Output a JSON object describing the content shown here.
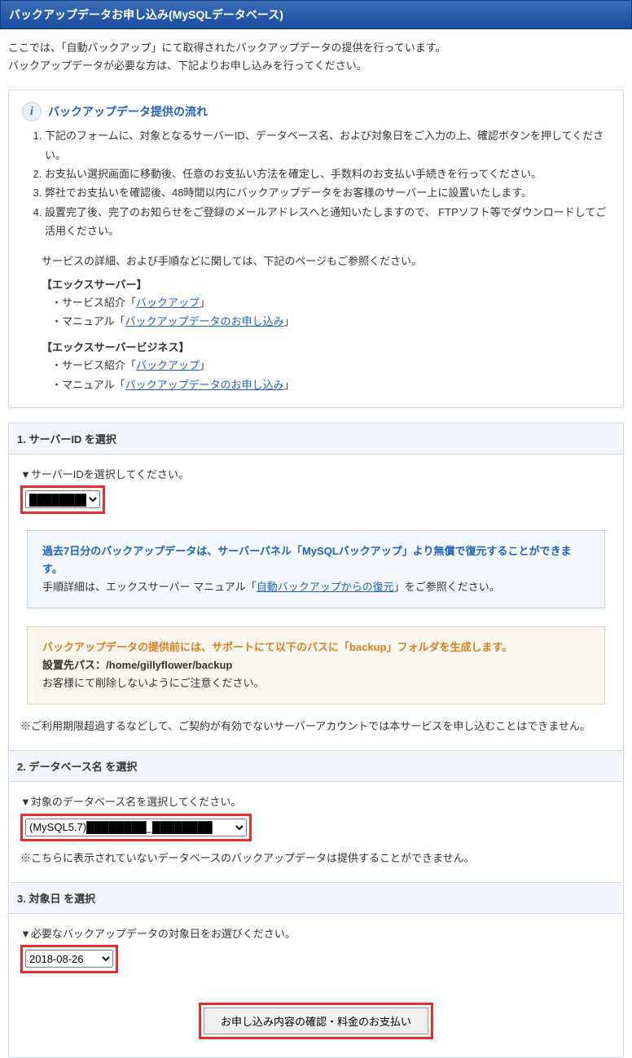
{
  "title": "バックアップデータお申し込み(MySQLデータベース)",
  "intro": {
    "line1": "ここでは、「自動バックアップ」にて取得されたバックアップデータの提供を行っています。",
    "line2": "バックアップデータが必要な方は、下記よりお申し込みを行ってください。"
  },
  "info": {
    "heading": "バックアップデータ提供の流れ",
    "steps": [
      "下記のフォームに、対象となるサーバーID、データベース名、および対象日をご入力の上、確認ボタンを押してください。",
      "お支払い選択画面に移動後、任意のお支払い方法を確定し、手数料のお支払い手続きを行ってください。",
      "弊社でお支払いを確認後、48時間以内にバックアップデータをお客様のサーバー上に設置いたします。",
      "設置完了後、完了のお知らせをご登録のメールアドレスへと通知いたしますので、 FTPソフト等でダウンロードしてご活用ください。"
    ],
    "detail_line": "サービスの詳細、および手順などに関しては、下記のページもご参照ください。",
    "groups": [
      {
        "head": "【エックスサーバー】",
        "lines": [
          {
            "prefix": "・サービス紹介「",
            "link": "バックアップ",
            "suffix": "」"
          },
          {
            "prefix": "・マニュアル「",
            "link": "バックアップデータのお申し込み",
            "suffix": "」"
          }
        ]
      },
      {
        "head": "【エックスサーバービジネス】",
        "lines": [
          {
            "prefix": "・サービス紹介「",
            "link": "バックアップ",
            "suffix": "」"
          },
          {
            "prefix": "・マニュアル「",
            "link": "バックアップデータのお申し込み",
            "suffix": "」"
          }
        ]
      }
    ]
  },
  "sec1": {
    "title": "1. サーバーID を選択",
    "label": "▼サーバーIDを選択してください。",
    "select_value": "████████",
    "bluebox_title": "過去7日分のバックアップデータは、サーバーパネル「MySQLバックアップ」より無償で復元することができます。",
    "bluebox_pre": "手順詳細は、エックスサーバー マニュアル「",
    "bluebox_link": "自動バックアップからの復元",
    "bluebox_post": "」をご参照ください。",
    "orange_title": "バックアップデータの提供前には、サポートにて以下のパスに「backup」フォルダを生成します。",
    "orange_path_label": "設置先パス：",
    "orange_path": "/home/gillyflower/backup",
    "orange_note": "お客様にて削除しないようにご注意ください。",
    "note": "※ご利用期限超過するなどして、ご契約が有効でないサーバーアカウントでは本サービスを申し込むことはできません。"
  },
  "sec2": {
    "title": "2. データベース名 を選択",
    "label": "▼対象のデータベース名を選択してください。",
    "select_value": "(MySQL5.7)████████_████████",
    "note": "※こちらに表示されていないデータベースのバックアップデータは提供することができません。"
  },
  "sec3": {
    "title": "3. 対象日 を選択",
    "label": "▼必要なバックアップデータの対象日をお選びください。",
    "select_value": "2018-08-26"
  },
  "submit_label": "お申し込み内容の確認・料金のお支払い"
}
